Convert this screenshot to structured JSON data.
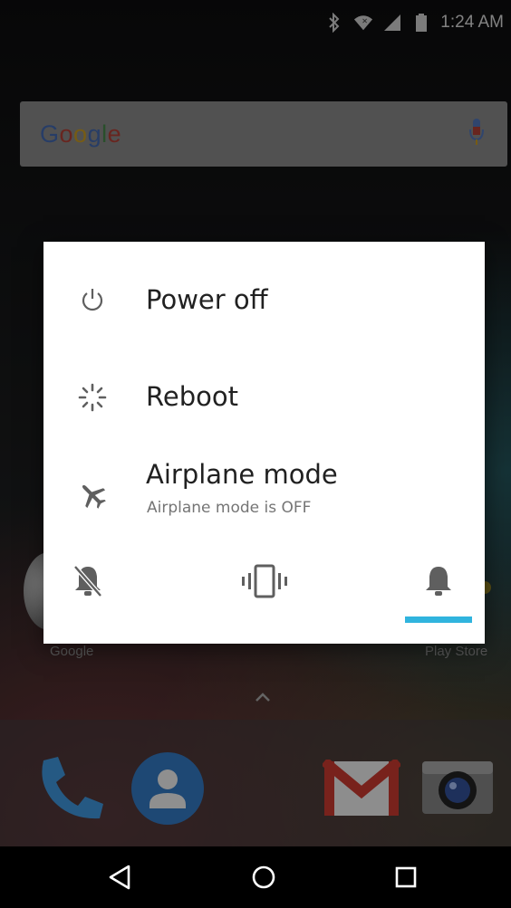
{
  "status_bar": {
    "time": "1:24 AM",
    "icons": [
      "bluetooth-icon",
      "wifi-icon",
      "signal-icon",
      "battery-icon"
    ]
  },
  "search_widget": {
    "logo_letters": [
      "G",
      "o",
      "o",
      "g",
      "l",
      "e"
    ],
    "mic_icon": "mic-icon"
  },
  "home_labels": {
    "left_app": "Google",
    "right_app": "Play Store"
  },
  "dock": {
    "apps": [
      "phone-icon",
      "contacts-icon",
      "gmail-icon",
      "camera-icon"
    ]
  },
  "power_dialog": {
    "items": [
      {
        "icon": "power-icon",
        "label": "Power off"
      },
      {
        "icon": "reboot-icon",
        "label": "Reboot"
      },
      {
        "icon": "airplane-icon",
        "label": "Airplane mode",
        "sublabel": "Airplane mode is OFF"
      }
    ],
    "ringer_modes": [
      {
        "icon": "silent-bell-icon",
        "selected": false
      },
      {
        "icon": "vibrate-icon",
        "selected": false
      },
      {
        "icon": "bell-icon",
        "selected": true
      }
    ],
    "accent_color": "#30b4de"
  },
  "nav_bar": {
    "buttons": [
      "back-icon",
      "home-icon",
      "recents-icon"
    ]
  }
}
